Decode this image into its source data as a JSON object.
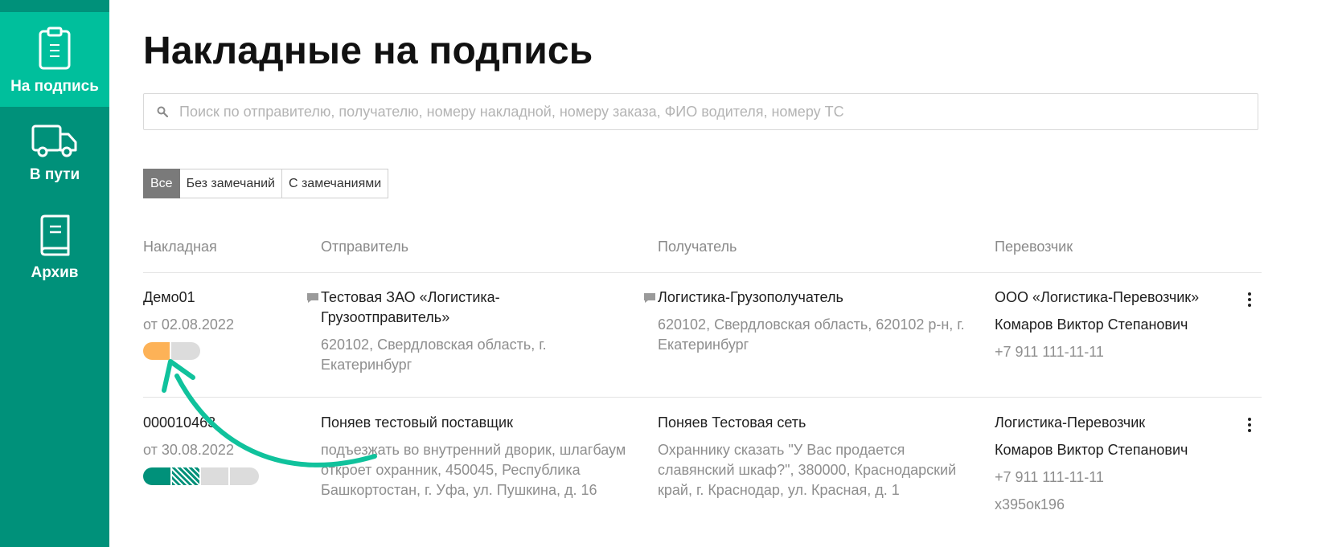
{
  "sidebar": {
    "items": [
      {
        "label": "На подпись",
        "icon": "clipboard-icon",
        "active": true
      },
      {
        "label": "В пути",
        "icon": "truck-icon",
        "active": false
      },
      {
        "label": "Архив",
        "icon": "book-icon",
        "active": false
      }
    ]
  },
  "page": {
    "title": "Накладные на подпись"
  },
  "search": {
    "placeholder": "Поиск по отправителю, получателю, номеру накладной, номеру заказа, ФИО водителя, номеру ТС",
    "value": ""
  },
  "filters": [
    {
      "label": "Все",
      "active": true
    },
    {
      "label": "Без замечаний",
      "active": false
    },
    {
      "label": "С замечаниями",
      "active": false
    }
  ],
  "table": {
    "columns": [
      "Накладная",
      "Отправитель",
      "Получатель",
      "Перевозчик"
    ],
    "rows": [
      {
        "number": "Демо01",
        "date": "от 02.08.2022",
        "sender_name": "Тестовая ЗАО «Логистика-Грузоотправитель»",
        "sender_name_lines": [
          "Тестовая ЗАО «Логистика-",
          "Грузоотправитель»"
        ],
        "sender_address_lines": [
          "620102, Свердловская область, г.",
          "Екатеринбург"
        ],
        "receiver_name": "Логистика-Грузополучатель",
        "receiver_address_lines": [
          "620102, Свердловская область, 620102 р-н, г.",
          "Екатеринбург"
        ],
        "carrier_name": "ООО «Логистика-Перевозчик»",
        "driver": "Комаров Виктор Степанович",
        "phone": "+7 911 111-11-11",
        "vehicle": ""
      },
      {
        "number": "000010463",
        "date": "от 30.08.2022",
        "sender_name": "Поняев тестовый поставщик",
        "sender_name_lines": [
          "Поняев тестовый поставщик"
        ],
        "sender_address_lines": [
          "подъезжать во внутренний дворик, шлагбаум",
          "откроет охранник, 450045, Республика",
          "Башкортостан, г. Уфа, ул. Пушкина, д. 16"
        ],
        "receiver_name": "Поняев Тестовая сеть",
        "receiver_address_lines": [
          "Охраннику сказать \"У Вас продается",
          "славянский шкаф?\", 380000, Краснодарский",
          "край, г. Краснодар, ул. Красная, д. 1"
        ],
        "carrier_name": "Логистика-Перевозчик",
        "driver": "Комаров Виктор Степанович",
        "phone": "+7 911 111-11-11",
        "vehicle": "х395ок196"
      }
    ]
  },
  "colors": {
    "sidebar": "#00917a",
    "sidebar_active": "#00bf9c",
    "accent": "#00bf9c",
    "status_orange": "#fdb257",
    "status_green": "#00917a",
    "status_grey": "#dcdcdc"
  }
}
